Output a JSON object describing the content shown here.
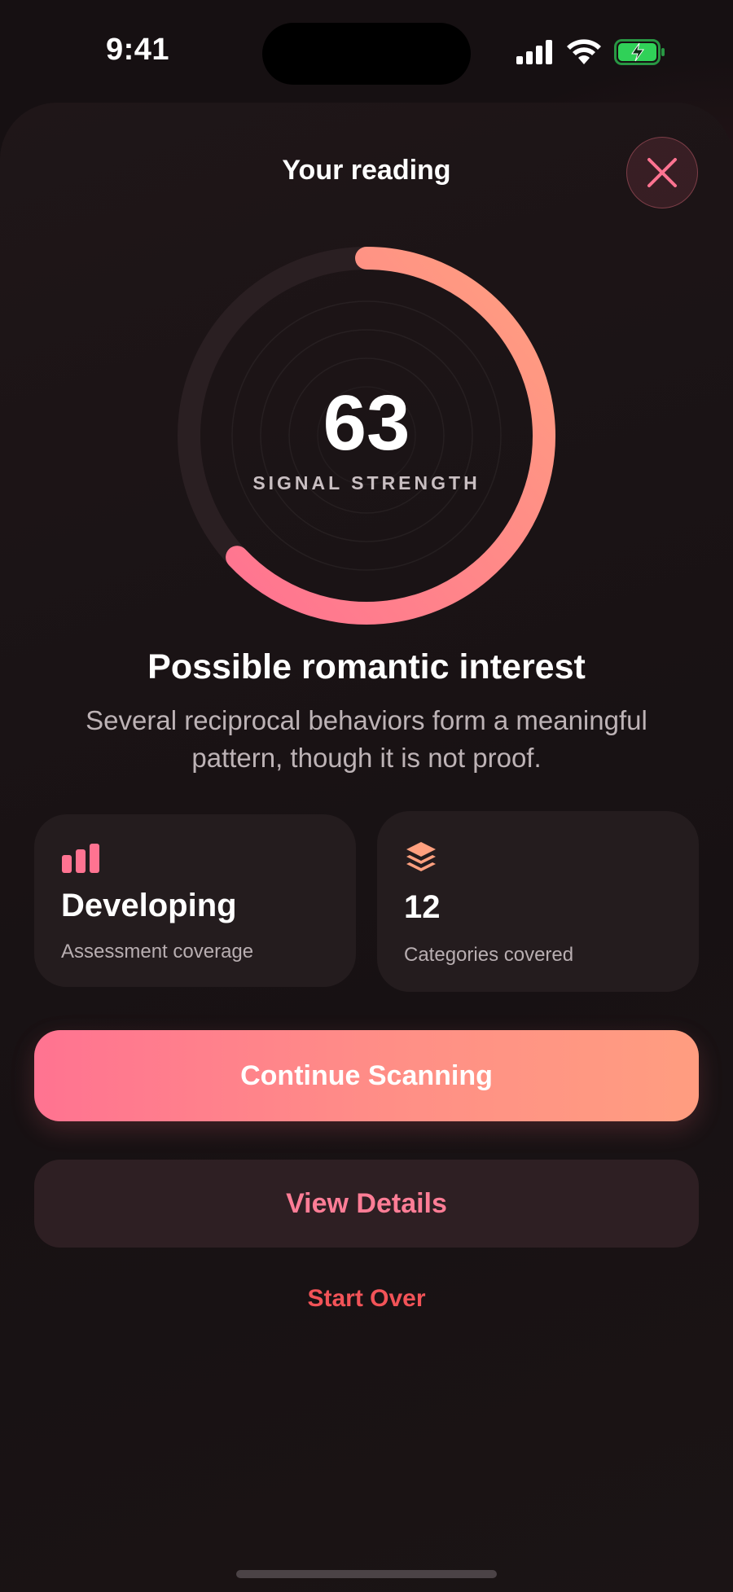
{
  "status_bar": {
    "time": "9:41",
    "icons": [
      "cellular-signal-icon",
      "wifi-icon",
      "battery-charging-icon"
    ],
    "battery_color": "#30d158"
  },
  "sheet": {
    "title": "Your reading",
    "close_icon": "close-icon"
  },
  "score": {
    "value": "63",
    "label": "SIGNAL STRENGTH",
    "fraction": 0.63,
    "gradient_start": "#ff7391",
    "gradient_end": "#ffa07f",
    "track_color": "#2a1f22"
  },
  "result": {
    "headline": "Possible romantic interest",
    "description": "Several reciprocal behaviors form a meaningful pattern, though it is not proof."
  },
  "stats": [
    {
      "icon": "bar-chart-icon",
      "value": "Developing",
      "caption": "Assessment coverage"
    },
    {
      "icon": "layers-icon",
      "value": "12",
      "caption": "Categories covered"
    }
  ],
  "actions": {
    "primary_label": "Continue Scanning",
    "secondary_label": "View Details",
    "tertiary_label": "Start Over"
  },
  "colors": {
    "accent": "#ff7391",
    "accent_end": "#ff9d80",
    "destructive": "#f25358",
    "background": "#161012"
  }
}
